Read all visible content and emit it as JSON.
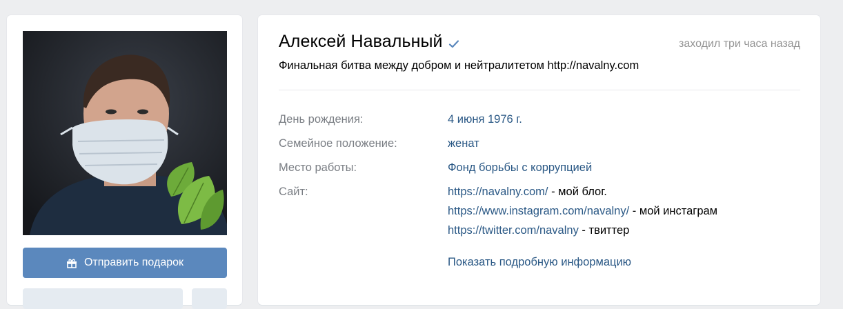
{
  "profile": {
    "name": "Алексей Навальный",
    "last_seen": "заходил три часа назад",
    "status": "Финальная битва между добром и нейтралитетом http://navalny.com"
  },
  "actions": {
    "gift_label": "Отправить подарок"
  },
  "info": {
    "birthday_label": "День рождения:",
    "birthday_value": "4 июня 1976 г.",
    "relationship_label": "Семейное положение:",
    "relationship_value": "женат",
    "work_label": "Место работы:",
    "work_value": "Фонд борьбы с коррупцией",
    "site_label": "Сайт:",
    "sites": [
      {
        "url": "https://navalny.com/",
        "desc": " - мой блог."
      },
      {
        "url": "https://www.instagram.com/navalny/",
        "desc": " - мой инстаграм"
      },
      {
        "url": "https://twitter.com/navalny",
        "desc": " - твиттер"
      }
    ],
    "show_more": "Показать подробную информацию"
  },
  "colors": {
    "accent": "#5b88bd",
    "link": "#2a5885",
    "background": "#edeef0"
  },
  "icons": [
    "gift-icon",
    "verified-check-icon"
  ]
}
